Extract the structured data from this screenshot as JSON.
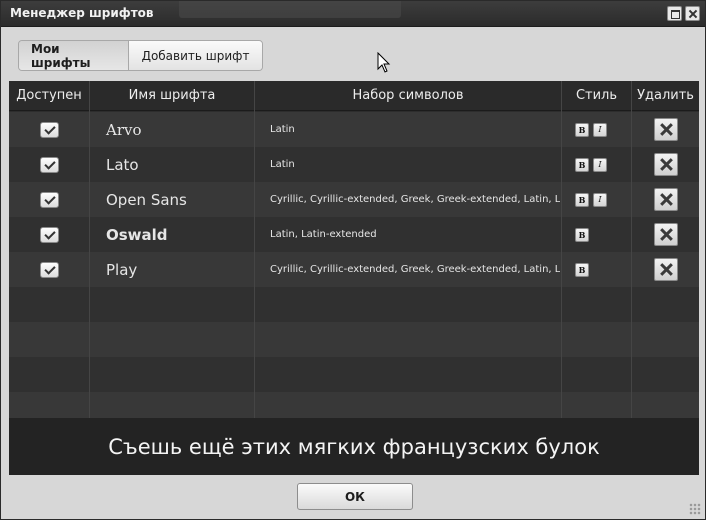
{
  "window": {
    "title": "Менеджер шрифтов"
  },
  "tabs": [
    {
      "label": "Мои шрифты",
      "active": true
    },
    {
      "label": "Добавить шрифт",
      "active": false
    }
  ],
  "table": {
    "headers": {
      "enabled": "Доступен",
      "name": "Имя шрифта",
      "charset": "Набор символов",
      "style": "Стиль",
      "delete": "Удалить"
    },
    "rows": [
      {
        "enabled": true,
        "name": "Arvo",
        "charset": "Latin",
        "styles": [
          "B",
          "I"
        ]
      },
      {
        "enabled": true,
        "name": "Lato",
        "charset": "Latin",
        "styles": [
          "B",
          "I"
        ]
      },
      {
        "enabled": true,
        "name": "Open Sans",
        "charset": "Cyrillic, Cyrillic-extended, Greek, Greek-extended, Latin, Latin-extended",
        "styles": [
          "B",
          "I"
        ]
      },
      {
        "enabled": true,
        "name": "Oswald",
        "charset": "Latin, Latin-extended",
        "styles": [
          "B"
        ]
      },
      {
        "enabled": true,
        "name": "Play",
        "charset": "Cyrillic, Cyrillic-extended, Greek, Greek-extended, Latin, Latin-extended",
        "styles": [
          "B"
        ]
      }
    ]
  },
  "preview": {
    "text": "Съешь ещё этих мягких французских булок"
  },
  "footer": {
    "ok_label": "ОК"
  },
  "icons": {
    "checkbox": "checkbox-checked-icon",
    "delete": "delete-x-icon",
    "maximize": "maximize-icon",
    "close": "close-icon",
    "cursor": "mouse-cursor-icon"
  }
}
